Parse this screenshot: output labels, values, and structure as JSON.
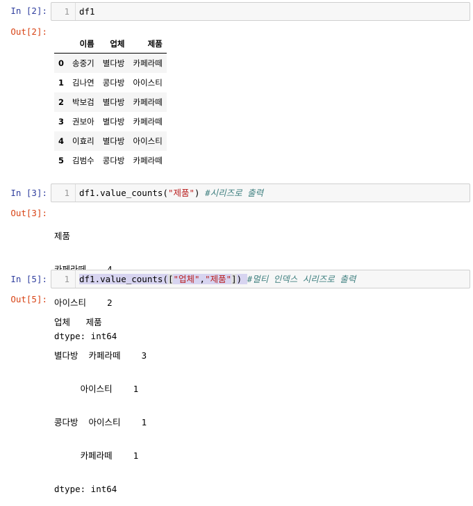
{
  "cells": {
    "c2": {
      "in_prompt": "In [2]:",
      "out_prompt": "Out[2]:",
      "line_no": "1",
      "code": "df1"
    },
    "c3": {
      "in_prompt": "In [3]:",
      "out_prompt": "Out[3]:",
      "line_no": "1",
      "code_prefix": "df1.value_counts(",
      "code_string": "\"제품\"",
      "code_suffix": ") ",
      "code_comment": "#시리즈로 출력"
    },
    "c5": {
      "in_prompt": "In [5]:",
      "out_prompt": "Out[5]:",
      "line_no": "1",
      "code_prefix": "df1.value_counts(",
      "code_bracket_open": "[",
      "code_string1": "\"업체\"",
      "code_comma": ",",
      "code_string2": "\"제품\"",
      "code_bracket_close": "]",
      "code_suffix": ") ",
      "code_comment": "#멀티 인덱스 시리즈로 출력"
    }
  },
  "dataframe": {
    "columns": [
      "이름",
      "업체",
      "제품"
    ],
    "rows": [
      {
        "index": "0",
        "values": [
          "송중기",
          "별다방",
          "카페라떼"
        ]
      },
      {
        "index": "1",
        "values": [
          "김나연",
          "콩다방",
          "아이스티"
        ]
      },
      {
        "index": "2",
        "values": [
          "박보검",
          "별다방",
          "카페라떼"
        ]
      },
      {
        "index": "3",
        "values": [
          "권보아",
          "별다방",
          "카페라떼"
        ]
      },
      {
        "index": "4",
        "values": [
          "이효리",
          "별다방",
          "아이스티"
        ]
      },
      {
        "index": "5",
        "values": [
          "김범수",
          "콩다방",
          "카페라떼"
        ]
      }
    ]
  },
  "output3": [
    "제품",
    "카페라떼    4",
    "아이스티    2",
    "dtype: int64"
  ],
  "output5": [
    "업체   제품",
    "별다방  카페라떼    3",
    "     아이스티    1",
    "콩다방  아이스티    1",
    "     카페라떼    1",
    "dtype: int64"
  ]
}
